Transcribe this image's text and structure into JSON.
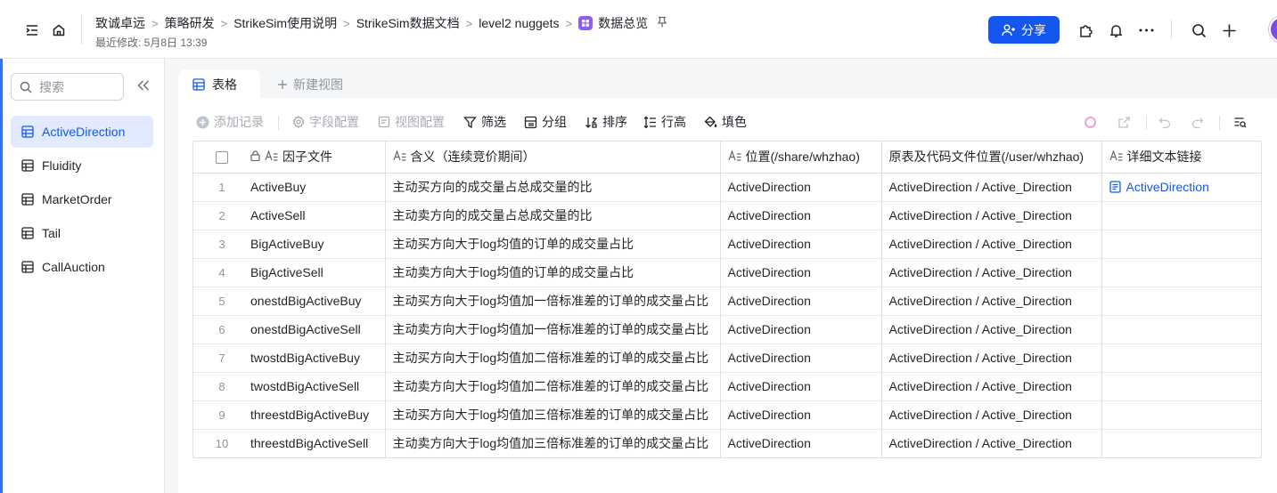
{
  "topbar": {
    "breadcrumbs": [
      "致诚卓远",
      "策略研发",
      "StrikeSim使用说明",
      "StrikeSim数据文档",
      "level2 nuggets"
    ],
    "current": "数据总览",
    "modified": "最近修改: 5月8日 13:39",
    "share_label": "分享"
  },
  "sidebar": {
    "search_placeholder": "搜索",
    "items": [
      {
        "label": "ActiveDirection",
        "active": true
      },
      {
        "label": "Fluidity",
        "active": false
      },
      {
        "label": "MarketOrder",
        "active": false
      },
      {
        "label": "Tail",
        "active": false
      },
      {
        "label": "CallAuction",
        "active": false
      }
    ]
  },
  "tabs": {
    "active_label": "表格",
    "new_view_label": "新建视图"
  },
  "toolbar": {
    "add_record": "添加记录",
    "field_config": "字段配置",
    "view_config": "视图配置",
    "filter": "筛选",
    "group": "分组",
    "sort": "排序",
    "row_height": "行高",
    "fill_color": "填色"
  },
  "table": {
    "columns": [
      "因子文件",
      "含义（连续竞价期间）",
      "位置(/share/whzhao)",
      "原表及代码文件位置(/user/whzhao)",
      "详细文本链接"
    ],
    "rows": [
      {
        "idx": "1",
        "name": "ActiveBuy",
        "meaning": "主动买方向的成交量占总成交量的比",
        "pos": "ActiveDirection",
        "src": "ActiveDirection / Active_Direction",
        "link": "ActiveDirection"
      },
      {
        "idx": "2",
        "name": "ActiveSell",
        "meaning": "主动卖方向的成交量占总成交量的比",
        "pos": "ActiveDirection",
        "src": "ActiveDirection / Active_Direction",
        "link": ""
      },
      {
        "idx": "3",
        "name": "BigActiveBuy",
        "meaning": "主动买方向大于log均值的订单的成交量占比",
        "pos": "ActiveDirection",
        "src": "ActiveDirection / Active_Direction",
        "link": ""
      },
      {
        "idx": "4",
        "name": "BigActiveSell",
        "meaning": "主动卖方向大于log均值的订单的成交量占比",
        "pos": "ActiveDirection",
        "src": "ActiveDirection / Active_Direction",
        "link": ""
      },
      {
        "idx": "5",
        "name": "onestdBigActiveBuy",
        "meaning": "主动买方向大于log均值加一倍标准差的订单的成交量占比",
        "pos": "ActiveDirection",
        "src": "ActiveDirection / Active_Direction",
        "link": ""
      },
      {
        "idx": "6",
        "name": "onestdBigActiveSell",
        "meaning": "主动卖方向大于log均值加一倍标准差的订单的成交量占比",
        "pos": "ActiveDirection",
        "src": "ActiveDirection / Active_Direction",
        "link": ""
      },
      {
        "idx": "7",
        "name": "twostdBigActiveBuy",
        "meaning": "主动买方向大于log均值加二倍标准差的订单的成交量占比",
        "pos": "ActiveDirection",
        "src": "ActiveDirection / Active_Direction",
        "link": ""
      },
      {
        "idx": "8",
        "name": "twostdBigActiveSell",
        "meaning": "主动卖方向大于log均值加二倍标准差的订单的成交量占比",
        "pos": "ActiveDirection",
        "src": "ActiveDirection / Active_Direction",
        "link": ""
      },
      {
        "idx": "9",
        "name": "threestdBigActiveBuy",
        "meaning": "主动买方向大于log均值加三倍标准差的订单的成交量占比",
        "pos": "ActiveDirection",
        "src": "ActiveDirection / Active_Direction",
        "link": ""
      },
      {
        "idx": "10",
        "name": "threestdBigActiveSell",
        "meaning": "主动卖方向大于log均值加三倍标准差的订单的成交量占比",
        "pos": "ActiveDirection",
        "src": "ActiveDirection / Active_Direction",
        "link": ""
      }
    ]
  },
  "colors": {
    "accent": "#1456f0",
    "active_bg": "#e1eaff",
    "app_icon": "#8f5cf7"
  }
}
